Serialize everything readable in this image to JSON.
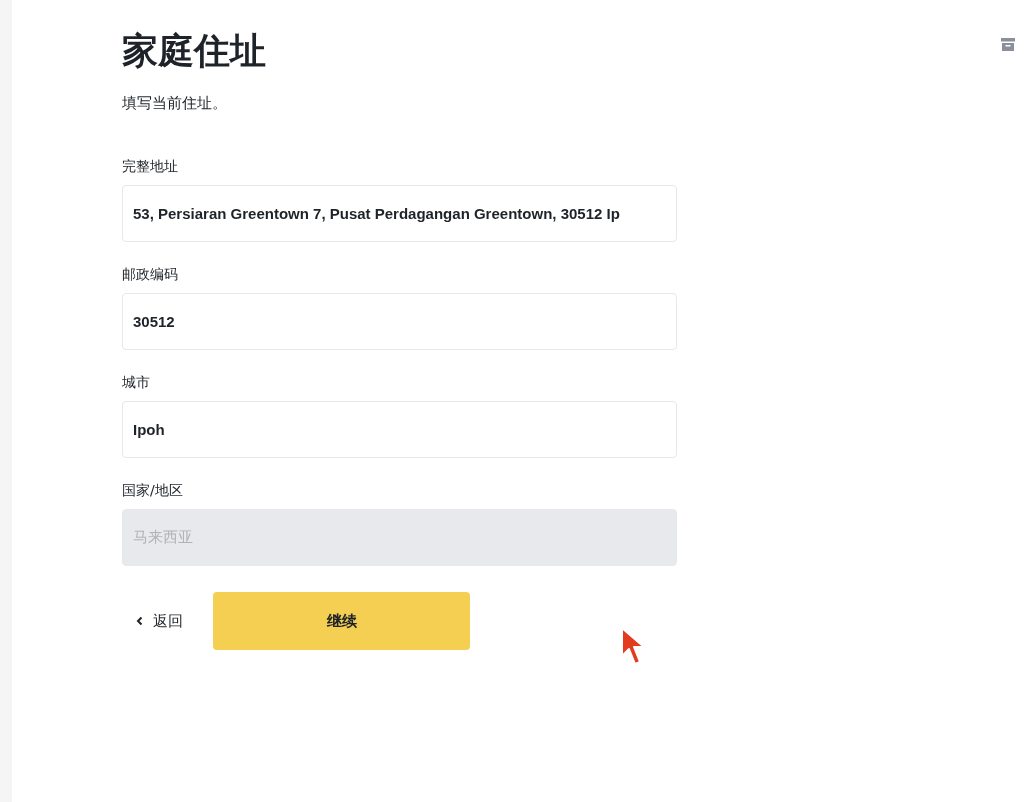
{
  "title": "家庭住址",
  "subtitle": "填写当前住址。",
  "fields": [
    {
      "label": "完整地址",
      "value": "53, Persiaran Greentown 7, Pusat Perdagangan Greentown, 30512 Ip",
      "disabled": false
    },
    {
      "label": "邮政编码",
      "value": "30512",
      "disabled": false
    },
    {
      "label": "城市",
      "value": "Ipoh",
      "disabled": false
    },
    {
      "label": "国家/地区",
      "value": "马来西亚",
      "disabled": true
    }
  ],
  "back_button": {
    "label": "返回"
  },
  "continue_button": {
    "label": "继续"
  }
}
